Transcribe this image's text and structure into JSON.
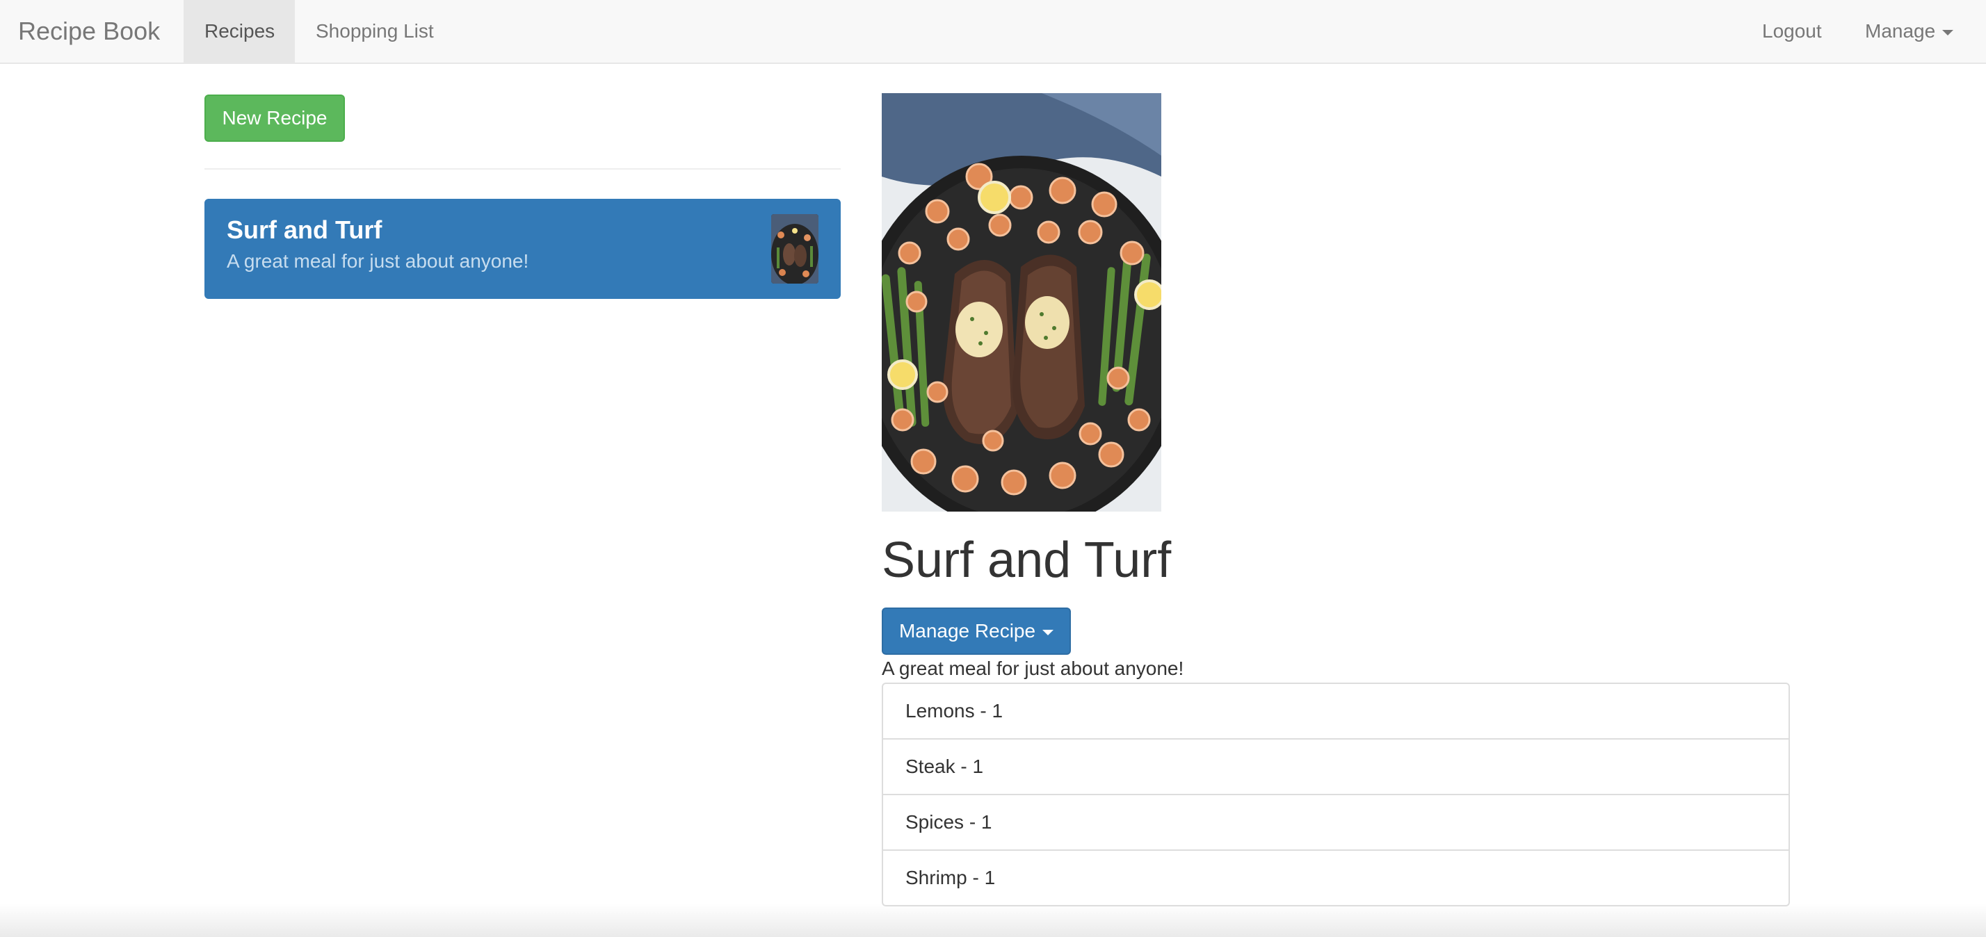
{
  "navbar": {
    "brand": "Recipe Book",
    "links": [
      {
        "label": "Recipes",
        "active": true
      },
      {
        "label": "Shopping List",
        "active": false
      }
    ],
    "right": {
      "logout": "Logout",
      "manage": "Manage"
    }
  },
  "sidebar": {
    "new_recipe_label": "New Recipe",
    "recipes": [
      {
        "name": "Surf and Turf",
        "description": "A great meal for just about anyone!",
        "thumbnail": "surf-and-turf-photo"
      }
    ]
  },
  "detail": {
    "image": "surf-and-turf-photo",
    "name": "Surf and Turf",
    "manage_label": "Manage Recipe",
    "description": "A great meal for just about anyone!",
    "ingredients": [
      "Lemons - 1",
      "Steak - 1",
      "Spices - 1",
      "Shrimp - 1"
    ]
  },
  "colors": {
    "success": "#5cb85c",
    "primary": "#337ab7",
    "navbar_bg": "#f8f8f8"
  }
}
